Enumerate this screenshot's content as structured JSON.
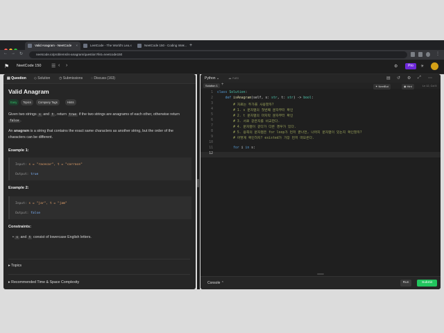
{
  "browser": {
    "tabs": [
      {
        "label": "Valid Anagram - NeetCode",
        "active": true
      },
      {
        "label": "LeetCode - The World's Lea...",
        "active": false
      },
      {
        "label": "NeetCode 150 - Coding Inter...",
        "active": false
      }
    ],
    "url": "neetcode.io/problems/is-anagram/question?list=neetcode150"
  },
  "app": {
    "list_name": "NeetCode 150",
    "pro_label": "Pro"
  },
  "left_tabs": [
    "Question",
    "Solution",
    "Submissions",
    "Discuss (163)"
  ],
  "question": {
    "title": "Valid Anagram",
    "tags": [
      "Easy",
      "Topics",
      "Company Tags",
      "Hints"
    ],
    "desc_pre": "Given two strings",
    "s": "s",
    "and": "and",
    "t": "t",
    "desc_mid": ", return",
    "true_code": "true",
    "desc_mid2": "if the two strings are anagrams of each other, otherwise return",
    "false_code": "false",
    "desc_end": ".",
    "anagram_pre": "An",
    "anagram_bold": "anagram",
    "anagram_rest": "is a string that contains the exact same characters as another string, but the order of the characters can be different.",
    "examples": [
      {
        "title": "Example 1:",
        "input_label": "Input:",
        "input": "s = \"racecar\", t = \"carrace\"",
        "output_label": "Output:",
        "output": "true"
      },
      {
        "title": "Example 2:",
        "input_label": "Input:",
        "input": "s = \"jar\", t = \"jam\"",
        "output_label": "Output:",
        "output": "false"
      }
    ],
    "constraints_title": "Constraints:",
    "constraint_s": "s",
    "constraint_and": "and",
    "constraint_t": "t",
    "constraint_rest": "consist of lowercase English letters.",
    "topics_label": "Topics",
    "complexity_label": "Recommended Time & Space Complexity"
  },
  "editor": {
    "language": "Python",
    "autosave": "Auto",
    "solution_tab": "Solution 1",
    "buttons": [
      "NeetBot",
      "Hint"
    ],
    "position": "Ln 12, Col 5",
    "lines": [
      {
        "n": "1",
        "text": "class Solution:"
      },
      {
        "n": "2",
        "text": "    def isAnagram(self, s: str, t: str) -> bool:"
      },
      {
        "n": "3",
        "text": "        # 자료는 두가를 사용할까?"
      },
      {
        "n": "4",
        "text": "        # 1. s 문자열의 첫번째 문자부터 확인"
      },
      {
        "n": "5",
        "text": "        # 2. t 문자열의 마지막 문자부터 확인"
      },
      {
        "n": "6",
        "text": "        # 3. 서로 같은지를 비교한다."
      },
      {
        "n": "7",
        "text": "        # 4. 문자열이 같다가 다른 경우가 있다."
      },
      {
        "n": "8",
        "text": "        # 5. 용쪽의 문자열은 for loop가 먼저 끝나면, 나머지 문자열이 있는지 확인할까?"
      },
      {
        "n": "9",
        "text": "        # 어떻게 확인하지? existed가 가장 먼저 떠오른다."
      },
      {
        "n": "10",
        "text": ""
      },
      {
        "n": "11",
        "text": "        for i in s:"
      },
      {
        "n": "12",
        "text": ""
      }
    ],
    "console_label": "Console",
    "run_label": "Run",
    "submit_label": "Submit"
  }
}
